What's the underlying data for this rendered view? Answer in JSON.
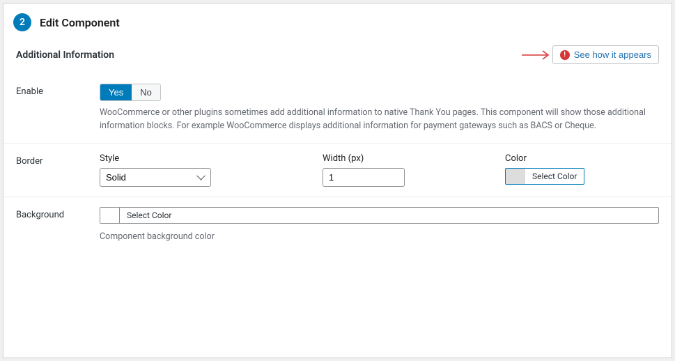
{
  "header": {
    "step": "2",
    "title": "Edit Component"
  },
  "section": {
    "title": "Additional Information",
    "see_link": "See how it appears"
  },
  "rows": {
    "enable": {
      "label": "Enable",
      "yes": "Yes",
      "no": "No",
      "help": "WooCommerce or other plugins sometimes add additional information to native Thank You pages. This component will show those additional information blocks. For example WooCommerce displays additional information for payment gateways such as BACS or Cheque."
    },
    "border": {
      "label": "Border",
      "style_label": "Style",
      "style_value": "Solid",
      "width_label": "Width (px)",
      "width_value": "1",
      "color_label": "Color",
      "select_color": "Select Color"
    },
    "background": {
      "label": "Background",
      "select_color": "Select Color",
      "help": "Component background color"
    }
  }
}
